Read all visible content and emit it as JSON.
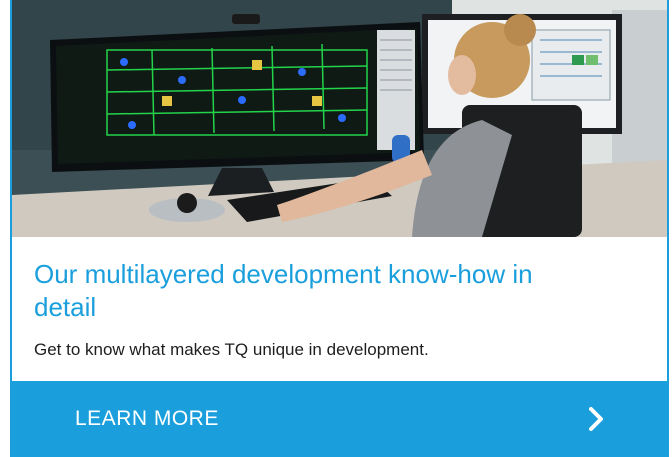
{
  "teaser": {
    "title": "Our multilayered development know-how in detail",
    "subtitle": "Get to know what makes TQ unique in development.",
    "cta_label": "LEARN MORE",
    "cta_icon": "chevron-right-icon",
    "image_description_icon": "engineer-at-pcb-design-workstation-photo"
  },
  "colors": {
    "accent": "#1a9fdc",
    "text": "#1e1e1e",
    "cta_text": "#ffffff"
  }
}
